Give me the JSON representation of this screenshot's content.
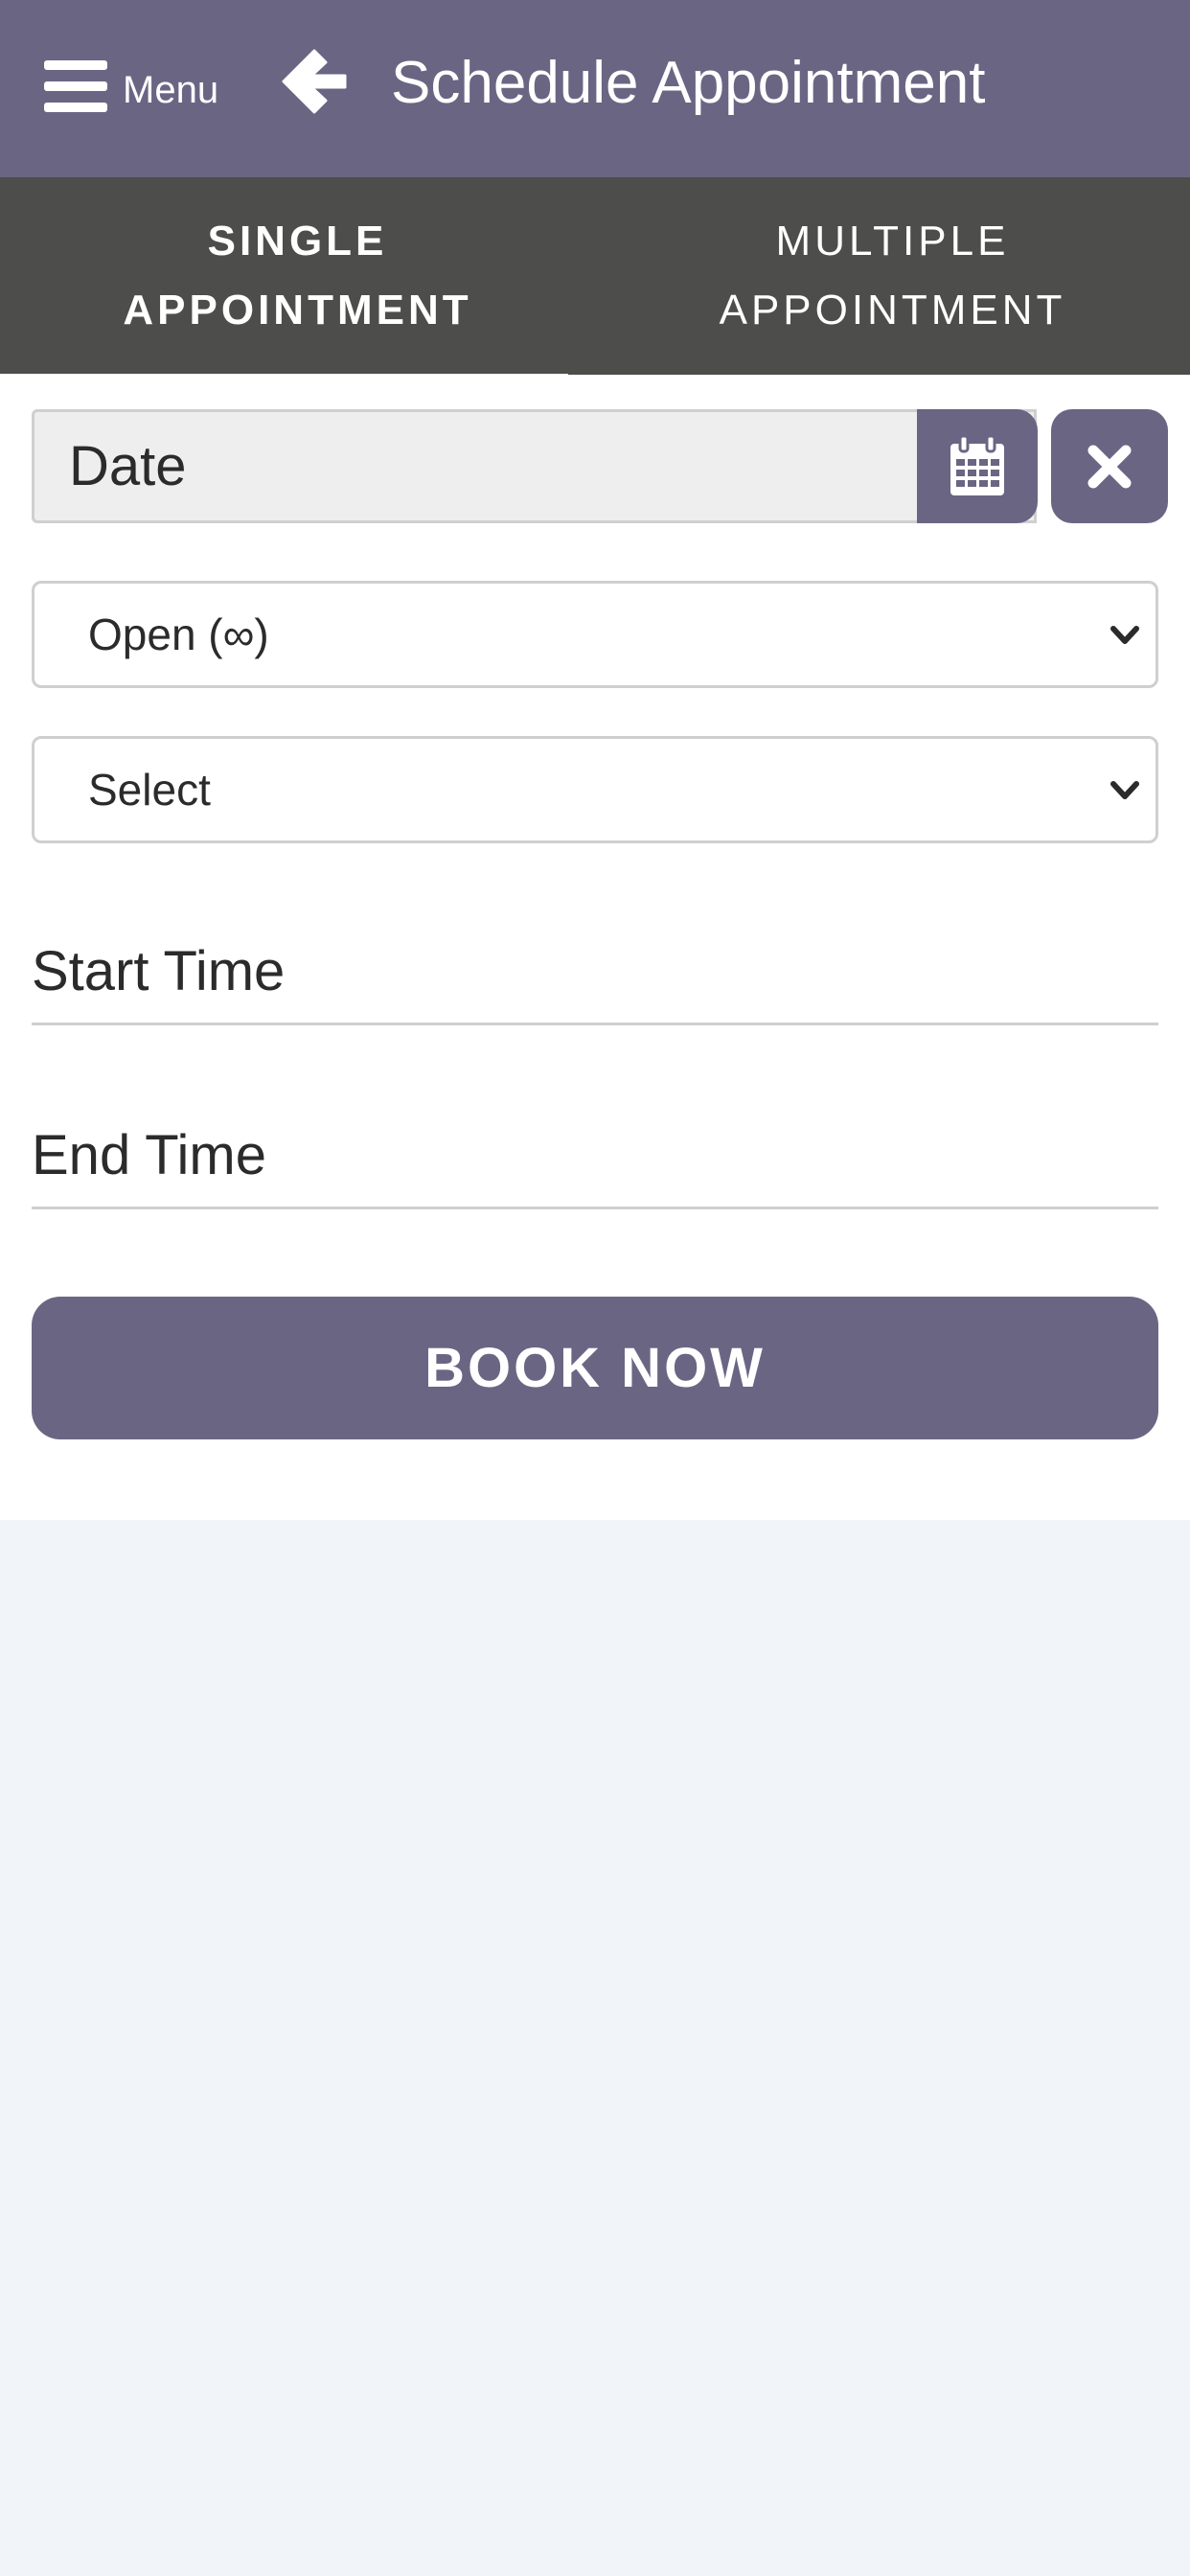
{
  "header": {
    "menu_label": "Menu",
    "title": "Schedule Appointment",
    "menu_icon": "hamburger-icon",
    "back_icon": "arrow-left-icon"
  },
  "tabs": [
    {
      "line1": "SINGLE",
      "line2": "APPOINTMENT",
      "active": true
    },
    {
      "line1": "MULTIPLE",
      "line2": "APPOINTMENT",
      "active": false
    }
  ],
  "form": {
    "date_placeholder": "Date",
    "calendar_icon": "calendar-icon",
    "clear_icon": "close-icon",
    "status_select": "Open (∞)",
    "second_select": "Select",
    "start_time_placeholder": "Start Time",
    "end_time_placeholder": "End Time",
    "submit_label": "BOOK NOW"
  },
  "colors": {
    "header": "#6b6584",
    "tabs": "#4d4d4b",
    "accent": "#6b6584",
    "background": "#f1f4f9"
  }
}
